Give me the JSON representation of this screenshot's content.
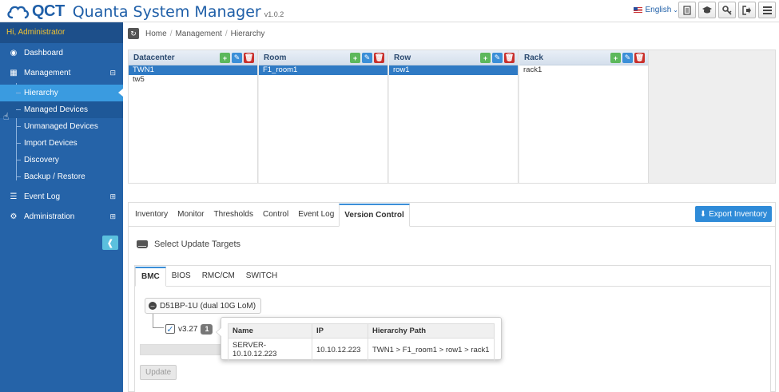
{
  "header": {
    "logo_text": "QCT",
    "app_title": "Quanta System Manager",
    "version": "v1.0.2",
    "language": "English",
    "buttons": [
      "document-icon",
      "graduation-cap-icon",
      "key-icon",
      "logout-icon",
      "menu-icon"
    ]
  },
  "sidebar": {
    "greeting": "Hi, Administrator",
    "dashboard": "Dashboard",
    "management": "Management",
    "management_items": [
      "Hierarchy",
      "Managed Devices",
      "Unmanaged Devices",
      "Import Devices",
      "Discovery",
      "Backup / Restore"
    ],
    "event_log": "Event Log",
    "administration": "Administration"
  },
  "breadcrumb": {
    "items": [
      "Home",
      "Management",
      "Hierarchy"
    ]
  },
  "hierarchy": {
    "columns": [
      {
        "title": "Datacenter",
        "rows": [
          "TWN1",
          "tw5"
        ],
        "selected": 0
      },
      {
        "title": "Room",
        "rows": [
          "F1_room1"
        ],
        "selected": 0
      },
      {
        "title": "Row",
        "rows": [
          "row1"
        ],
        "selected": 0
      },
      {
        "title": "Rack",
        "rows": [
          "rack1"
        ],
        "selected": -1
      }
    ]
  },
  "tabs": {
    "items": [
      "Inventory",
      "Monitor",
      "Thresholds",
      "Control",
      "Event Log",
      "Version Control"
    ],
    "active": "Version Control",
    "export_label": "Export Inventory"
  },
  "version_control": {
    "section_title": "Select Update Targets",
    "inner_tabs": [
      "BMC",
      "BIOS",
      "RMC/CM",
      "SWITCH"
    ],
    "active_inner_tab": "BMC",
    "model_node": "D51BP-1U (dual 10G LoM)",
    "version_leaf": "v3.27",
    "count_badge": "1",
    "update_label": "Update"
  },
  "popover": {
    "headers": [
      "Name",
      "IP",
      "Hierarchy Path"
    ],
    "rows": [
      [
        "SERVER-10.10.12.223",
        "10.10.12.223",
        "TWN1 > F1_room1 > row1 > rack1"
      ]
    ]
  },
  "colors": {
    "brand": "#1f5fa8",
    "sidebar": "#2563a8",
    "active_nav": "#3a9be0",
    "greeting": "#f1c232",
    "selected_row": "#2f7ac4"
  }
}
